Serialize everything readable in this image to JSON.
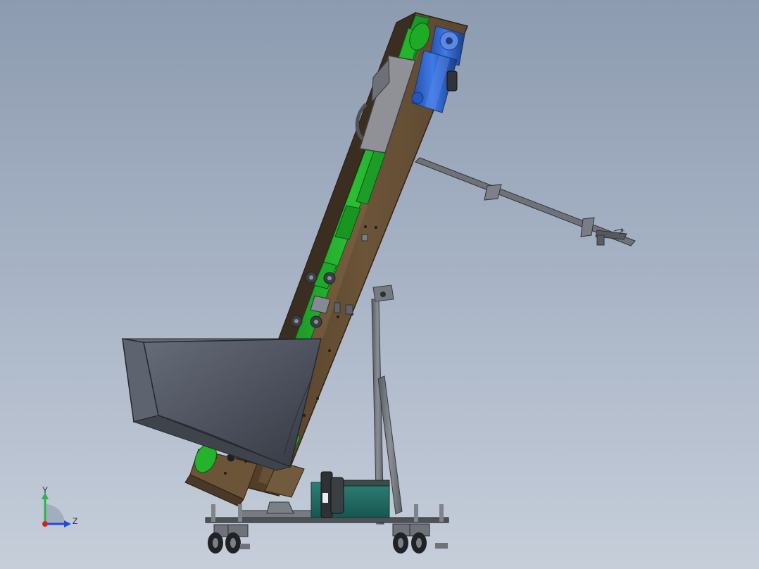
{
  "view": {
    "background_top": "#8d9bb0",
    "background_bottom": "#c6ceda"
  },
  "axes_triad": {
    "y_label": "Y",
    "z_label": "Z",
    "x_label": "",
    "y_color": "#2fb34a",
    "z_color": "#1d4fd6",
    "x_color": "#d92020",
    "icon": "coordinate-triad-icon"
  },
  "model": {
    "conveyor_frame_color": "#6b5438",
    "belt_color": "#27b12d",
    "motor_color": "#2f69d9",
    "hopper_color": "#4a4f5f",
    "base_color": "#1f6a61",
    "steel_color": "#7a7d83",
    "dark_color": "#2a2d30"
  }
}
